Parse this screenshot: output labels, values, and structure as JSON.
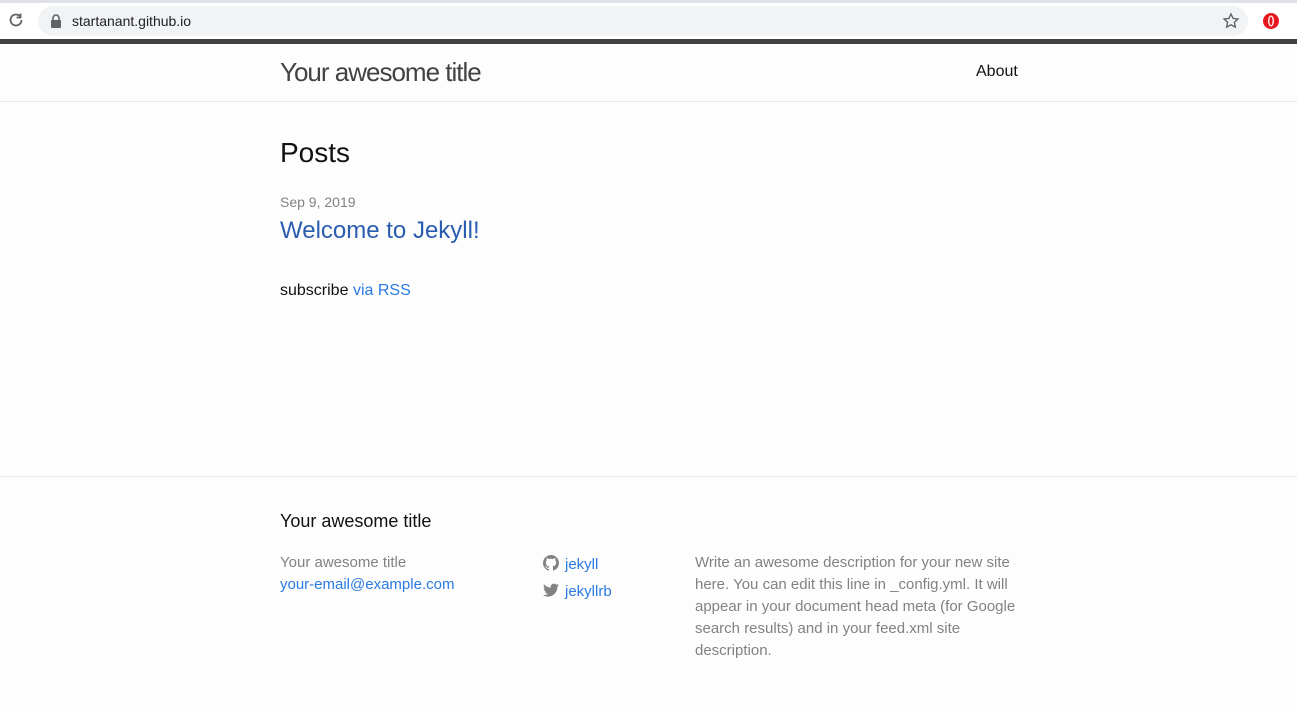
{
  "browser": {
    "url": "startanant.github.io"
  },
  "header": {
    "site_title": "Your awesome title",
    "nav": [
      {
        "label": "About"
      }
    ]
  },
  "main": {
    "heading": "Posts",
    "posts": [
      {
        "date": "Sep 9, 2019",
        "title": "Welcome to Jekyll!"
      }
    ],
    "subscribe_text": "subscribe",
    "rss_label": "via RSS"
  },
  "footer": {
    "heading": "Your awesome title",
    "name": "Your awesome title",
    "email": "your-email@example.com",
    "social": [
      {
        "icon": "github-icon",
        "label": "jekyll"
      },
      {
        "icon": "twitter-icon",
        "label": "jekyllrb"
      }
    ],
    "description": "Write an awesome description for your new site here. You can edit this line in _config.yml. It will appear in your document head meta (for Google search results) and in your feed.xml site description."
  },
  "colors": {
    "link": "#2a7ae2",
    "post_link": "#2a5db0",
    "muted": "#828282",
    "rule": "#424242"
  }
}
